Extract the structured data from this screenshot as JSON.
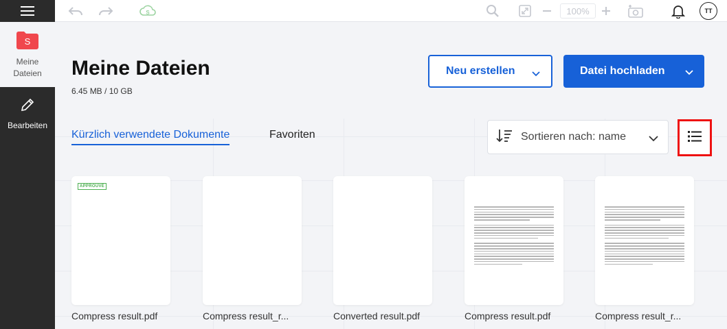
{
  "topbar": {
    "zoom_value": "100%",
    "avatar_initials": "TT",
    "cloud_letter": "S"
  },
  "sidebar": {
    "items": [
      {
        "label_line1": "Meine",
        "label_line2": "Dateien",
        "icon": "folder-icon",
        "letter": "S"
      },
      {
        "label": "Bearbeiten",
        "icon": "pencil-icon"
      }
    ]
  },
  "main": {
    "title": "Meine Dateien",
    "storage": "6.45 MB / 10 GB",
    "new_button": "Neu erstellen",
    "upload_button": "Datei hochladen",
    "tabs": [
      {
        "label": "Kürzlich verwendete Dokumente",
        "active": true
      },
      {
        "label": "Favoriten",
        "active": false
      }
    ],
    "sort_label": "Sortieren nach: name"
  },
  "files": [
    {
      "name": "Compress result.pdf",
      "stamp": "APPROUVÉ"
    },
    {
      "name": "Compress result_r..."
    },
    {
      "name": "Converted result.pdf"
    },
    {
      "name": "Compress result.pdf"
    },
    {
      "name": "Compress result_r..."
    }
  ],
  "colors": {
    "accent": "#1761d8",
    "sidebar_bg": "#2b2b2b",
    "brand_red": "#f0474d",
    "highlight_border": "#ee1111"
  }
}
